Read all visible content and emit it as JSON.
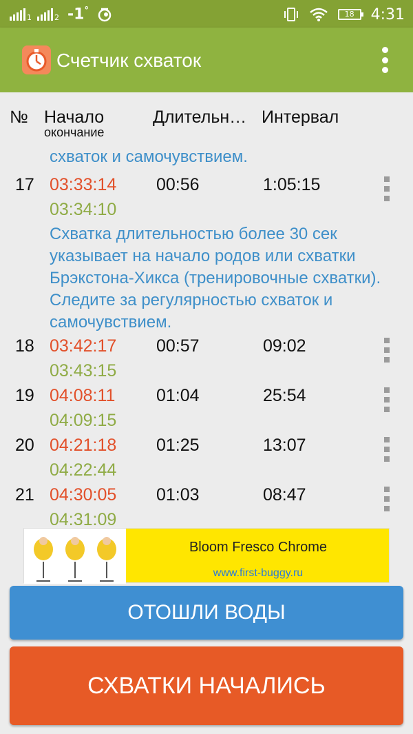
{
  "status_bar": {
    "sim1": "1",
    "sim2": "2",
    "temperature": "-1",
    "degree": "°",
    "battery": "18",
    "time": "4:31"
  },
  "app_bar": {
    "title": "Счетчик схваток"
  },
  "table_header": {
    "num": "№",
    "start": "Начало",
    "end": "окончание",
    "duration": "Длительн…",
    "interval": "Интервал"
  },
  "partial_note": "схваток и самочувствием.",
  "rows": [
    {
      "num": "17",
      "start": "03:33:14",
      "end": "03:34:10",
      "duration": "00:56",
      "interval": "1:05:15",
      "note": "Схватка длительностью более 30 сек указывает на начало родов или схватки Брэкстона-Хикса (тренировочные схватки). Следите за регулярностью схваток и самочувствием."
    },
    {
      "num": "18",
      "start": "03:42:17",
      "end": "03:43:15",
      "duration": "00:57",
      "interval": "09:02"
    },
    {
      "num": "19",
      "start": "04:08:11",
      "end": "04:09:15",
      "duration": "01:04",
      "interval": "25:54"
    },
    {
      "num": "20",
      "start": "04:21:18",
      "end": "04:22:44",
      "duration": "01:25",
      "interval": "13:07"
    },
    {
      "num": "21",
      "start": "04:30:05",
      "end": "04:31:09",
      "duration": "01:03",
      "interval": "08:47"
    }
  ],
  "ad": {
    "title": "Bloom Fresco Chrome",
    "url": "www.first-buggy.ru"
  },
  "buttons": {
    "water": "ОТОШЛИ ВОДЫ",
    "contractions": "СХВАТКИ НАЧАЛИСЬ"
  },
  "colors": {
    "app_bar": "#8fb340",
    "start_time": "#e2502a",
    "end_time": "#8fab45",
    "note": "#3e8fc9",
    "water_button": "#3f8fd2",
    "contractions_button": "#e75a26"
  }
}
